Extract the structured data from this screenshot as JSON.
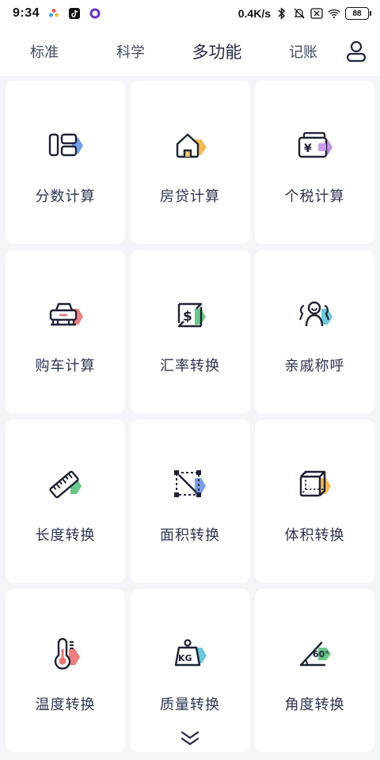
{
  "status_bar": {
    "time": "9:34",
    "network_speed": "0.4K/s",
    "battery": "88",
    "icons": [
      "app-colorful-icon",
      "tiktok-icon",
      "circle-app-icon",
      "bluetooth-icon",
      "mute-bell-icon",
      "sim-x-icon",
      "wifi-icon",
      "battery-icon"
    ]
  },
  "nav": {
    "tabs": [
      {
        "label": "标准"
      },
      {
        "label": "科学"
      },
      {
        "label": "多功能",
        "active": true
      },
      {
        "label": "记账"
      }
    ],
    "user_icon": "user-icon"
  },
  "tools": [
    {
      "label": "分数计算",
      "icon": "fraction-icon",
      "accent": "#5b8def"
    },
    {
      "label": "房贷计算",
      "icon": "house-icon",
      "accent": "#f5b43c"
    },
    {
      "label": "个税计算",
      "icon": "wallet-yuan-icon",
      "accent": "#b57be8"
    },
    {
      "label": "购车计算",
      "icon": "car-icon",
      "accent": "#f07070"
    },
    {
      "label": "汇率转换",
      "icon": "exchange-dollar-icon",
      "accent": "#57c27a"
    },
    {
      "label": "亲戚称呼",
      "icon": "family-icon",
      "accent": "#59c3d6"
    },
    {
      "label": "长度转换",
      "icon": "ruler-icon",
      "accent": "#57c27a"
    },
    {
      "label": "面积转换",
      "icon": "area-icon",
      "accent": "#5b8def"
    },
    {
      "label": "体积转换",
      "icon": "cube-icon",
      "accent": "#f5b43c"
    },
    {
      "label": "温度转换",
      "icon": "thermometer-icon",
      "accent": "#f07070"
    },
    {
      "label": "质量转换",
      "icon": "weight-kg-icon",
      "accent": "#59c3d6"
    },
    {
      "label": "角度转换",
      "icon": "angle-icon",
      "accent": "#57c27a"
    }
  ],
  "icon_text": {
    "yuan": "¥",
    "dollar": "$",
    "kg": "KG",
    "angle": "60°"
  },
  "more_icon": "double-chevron-down-icon"
}
